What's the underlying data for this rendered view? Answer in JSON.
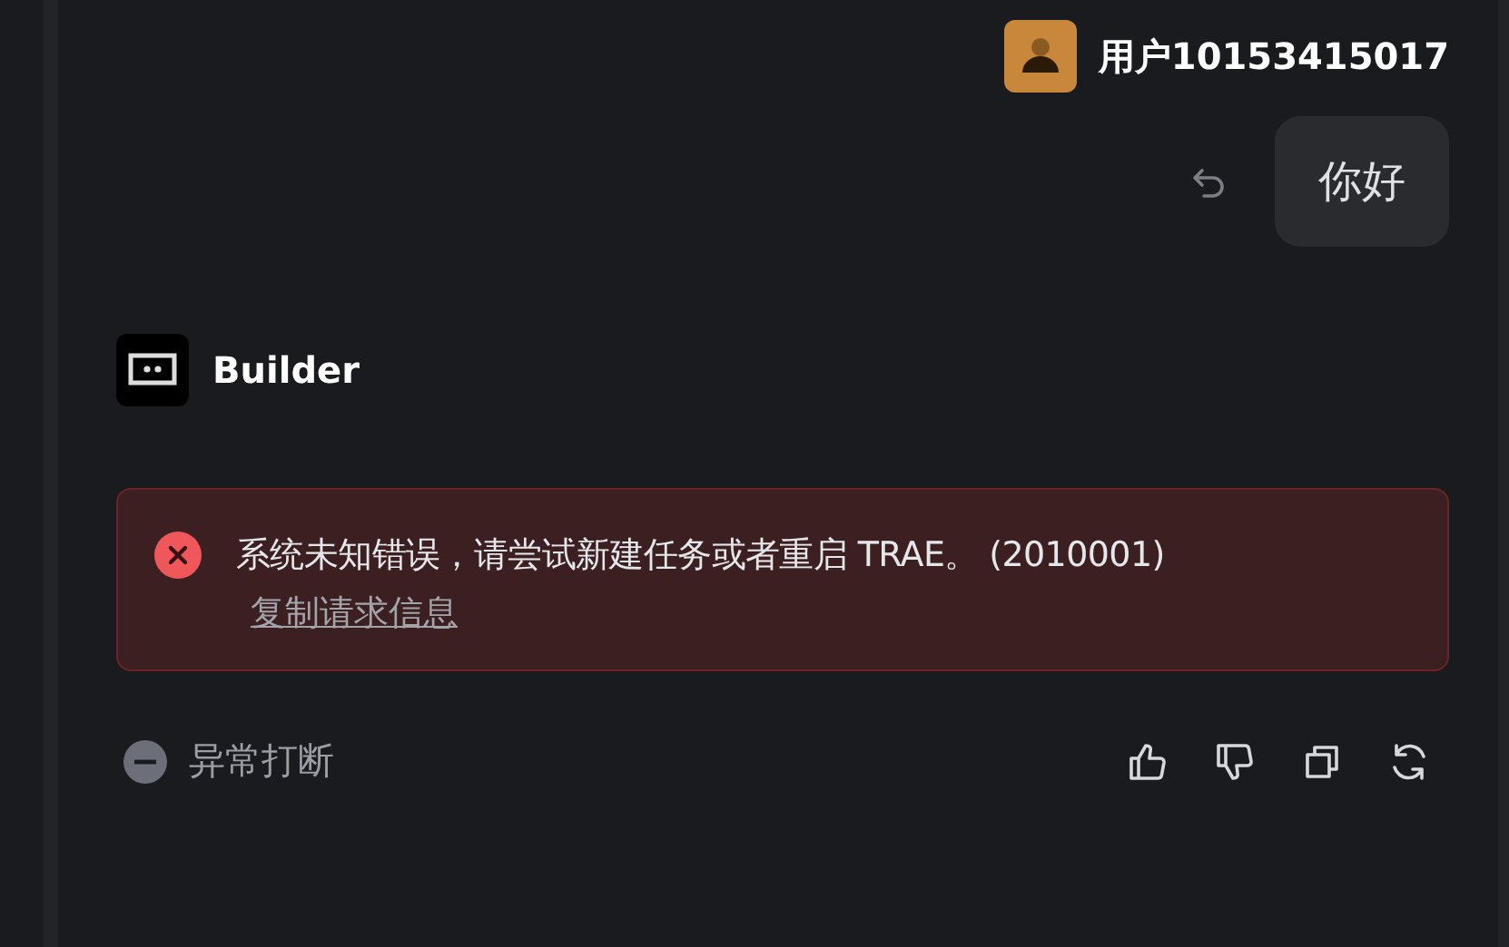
{
  "user": {
    "name": "用户10153415017"
  },
  "user_message": {
    "text": "你好"
  },
  "assistant": {
    "name": "Builder"
  },
  "error": {
    "message": "系统未知错误，请尝试新建任务或者重启 TRAE。 (2010001)",
    "link": "复制请求信息"
  },
  "status": {
    "text": "异常打断"
  }
}
